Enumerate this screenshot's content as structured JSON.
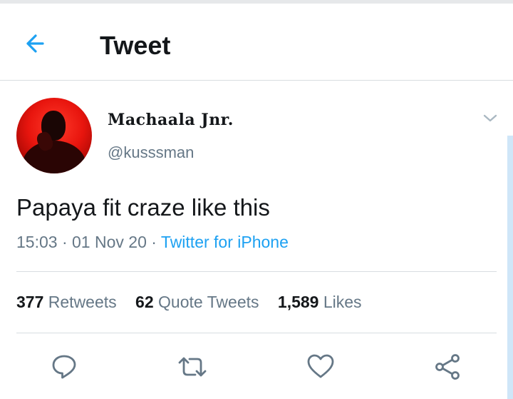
{
  "header": {
    "title": "Tweet",
    "back_icon": "arrow-left-icon"
  },
  "colors": {
    "accent": "#1da1f2",
    "secondary_text": "#657786",
    "primary_text": "#14171a",
    "divider": "#d8dde1"
  },
  "tweet": {
    "author": {
      "display_name": "Machaala Jnr.",
      "handle": "@kusssman"
    },
    "text": "Papaya fit craze like this",
    "time": "15:03",
    "separator": "·",
    "date": "01 Nov 20",
    "source": "Twitter for iPhone"
  },
  "stats": {
    "retweets_count": "377",
    "retweets_label": "Retweets",
    "quotes_count": "62",
    "quotes_label": "Quote Tweets",
    "likes_count": "1,589",
    "likes_label": "Likes"
  },
  "actions": [
    "reply-icon",
    "retweet-icon",
    "like-icon",
    "share-icon"
  ]
}
